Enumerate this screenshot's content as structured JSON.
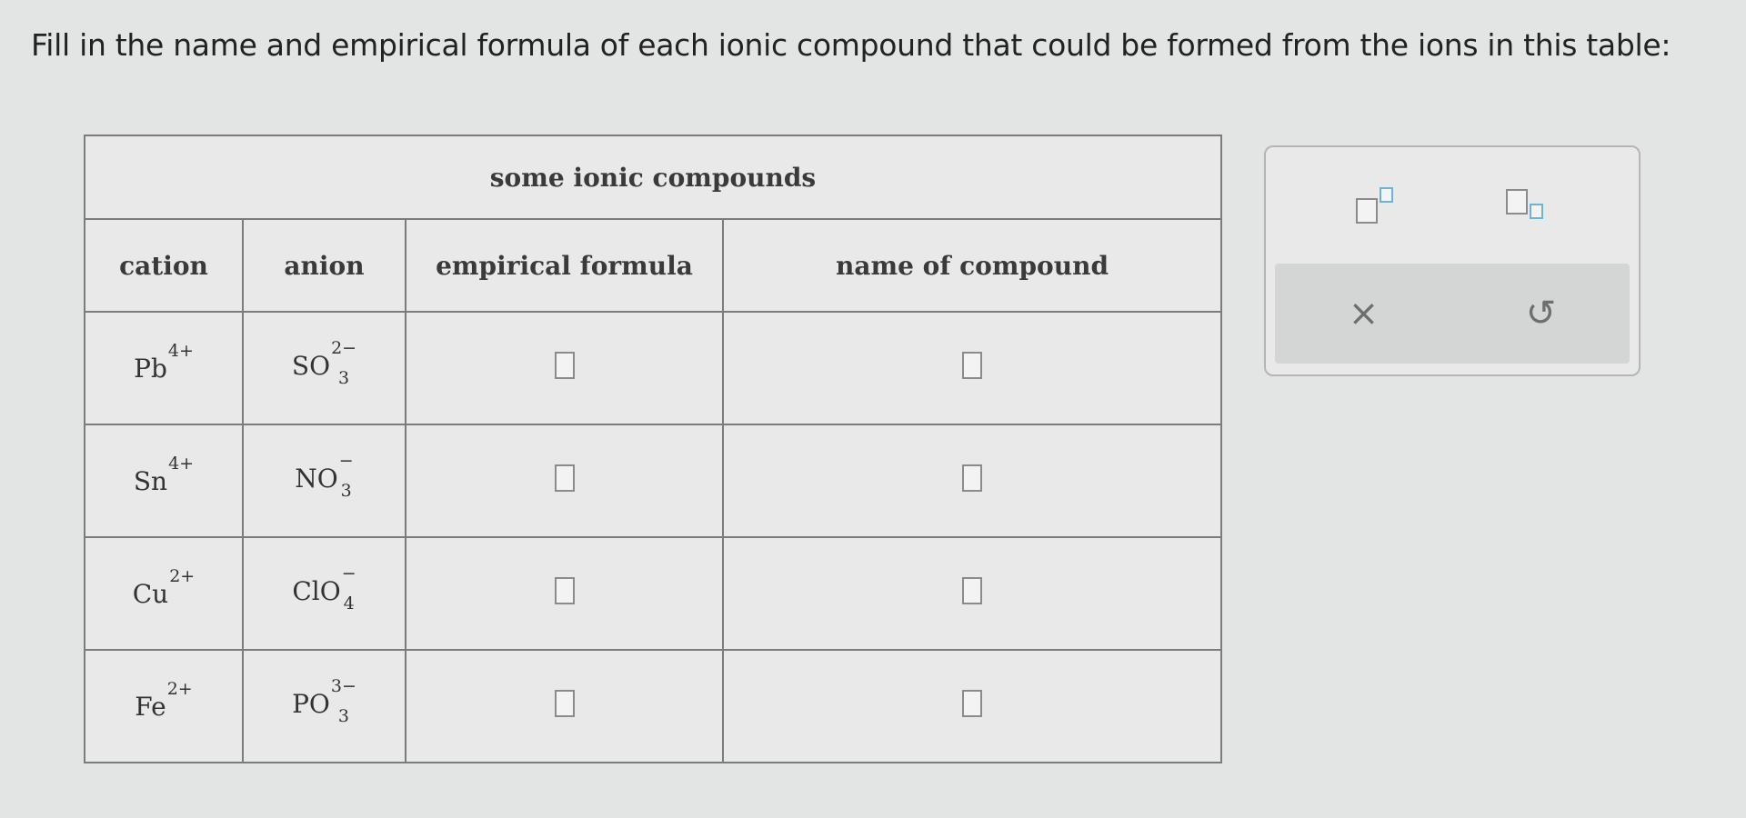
{
  "instructions": "Fill in the name and empirical formula of each ionic compound that could be formed from the ions in this table:",
  "table": {
    "caption": "some ionic compounds",
    "headers": {
      "cation": "cation",
      "anion": "anion",
      "formula": "empirical formula",
      "name": "name of compound"
    },
    "rows": [
      {
        "cation": {
          "symbol": "Pb",
          "charge": "4+"
        },
        "anion": {
          "symbol": "SO",
          "sub": "3",
          "charge": "2−"
        },
        "formula": "",
        "name": ""
      },
      {
        "cation": {
          "symbol": "Sn",
          "charge": "4+"
        },
        "anion": {
          "symbol": "NO",
          "sub": "3",
          "charge": "−"
        },
        "formula": "",
        "name": ""
      },
      {
        "cation": {
          "symbol": "Cu",
          "charge": "2+"
        },
        "anion": {
          "symbol": "ClO",
          "sub": "4",
          "charge": "−"
        },
        "formula": "",
        "name": ""
      },
      {
        "cation": {
          "symbol": "Fe",
          "charge": "2+"
        },
        "anion": {
          "symbol": "PO",
          "sub": "3",
          "charge": "3−"
        },
        "formula": "",
        "name": ""
      }
    ]
  },
  "tools": {
    "superscript_icon": "superscript-icon",
    "subscript_icon": "subscript-icon",
    "clear_glyph": "×",
    "undo_glyph": "↺",
    "accent_color": "#6fb2d6"
  }
}
